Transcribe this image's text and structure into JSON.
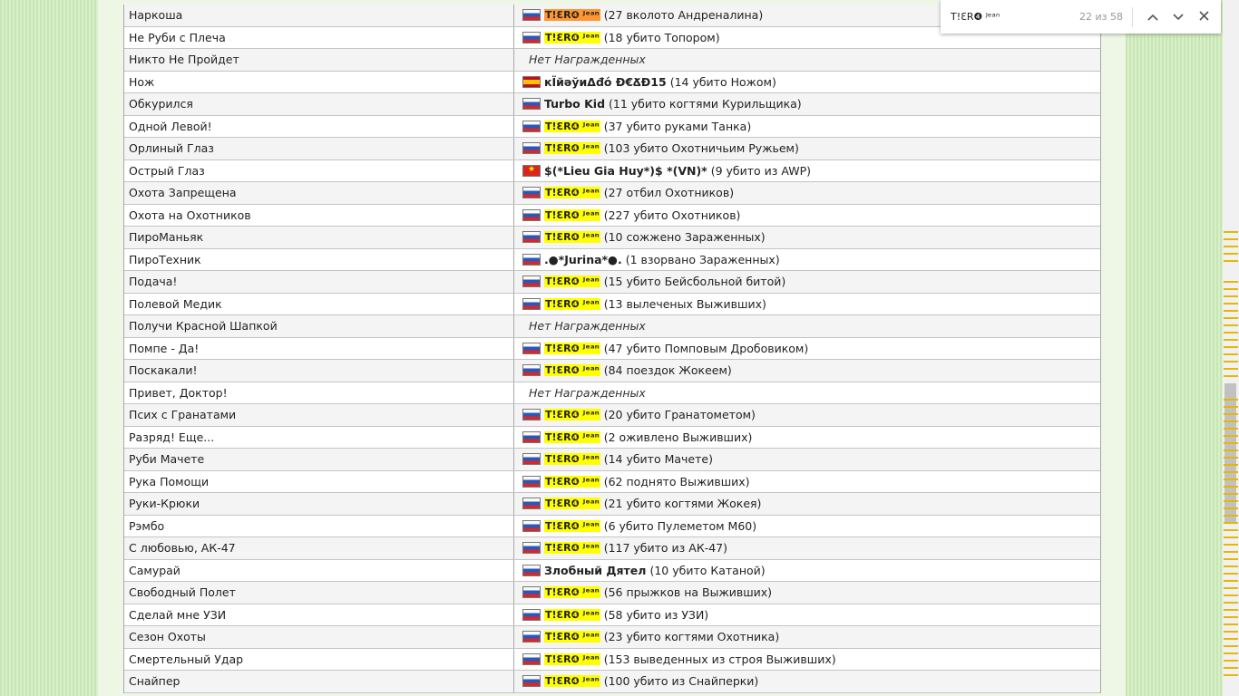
{
  "find": {
    "query": "T!ƐR❹ ᴶᵉᵃⁿ",
    "count": "22 из 58",
    "prev_icon": "chevron-up-icon",
    "next_icon": "chevron-down-icon",
    "close_icon": "close-icon"
  },
  "rows": [
    {
      "award": "Наркоша",
      "flag": "ru",
      "name": "T!ƐR❹ ᴶᵉᵃⁿ",
      "hl": true,
      "current": true,
      "detail": "(27 вколото Андреналина)"
    },
    {
      "award": "Не Руби с Плеча",
      "flag": "ru",
      "name": "T!ƐR❹ ᴶᵉᵃⁿ",
      "hl": true,
      "detail": "(18 убито Топором)"
    },
    {
      "award": "Никто Не Пройдет",
      "none": "Нет Награжденных"
    },
    {
      "award": "Нож",
      "flag": "es",
      "name": "кЇйәўиΔđό Ð€ՃĐ15",
      "detail": "(14 убито Ножом)"
    },
    {
      "award": "Обкурился",
      "flag": "ru",
      "name": "Turbo Kid",
      "detail": "(11 убито когтями Курильщика)"
    },
    {
      "award": "Одной Левой!",
      "flag": "ru",
      "name": "T!ƐR❹ ᴶᵉᵃⁿ",
      "hl": true,
      "detail": "(37 убито руками Танка)"
    },
    {
      "award": "Орлиный Глаз",
      "flag": "ru",
      "name": "T!ƐR❹ ᴶᵉᵃⁿ",
      "hl": true,
      "detail": "(103 убито Охотничьим Ружьем)"
    },
    {
      "award": "Острый Глаз",
      "flag": "vn",
      "name": "$(*Lieu Gia Huy*)$ *(VN)*",
      "detail": "(9 убито из AWP)"
    },
    {
      "award": "Охота Запрещена",
      "flag": "ru",
      "name": "T!ƐR❹ ᴶᵉᵃⁿ",
      "hl": true,
      "detail": "(27 отбил Охотников)"
    },
    {
      "award": "Охота на Охотников",
      "flag": "ru",
      "name": "T!ƐR❹ ᴶᵉᵃⁿ",
      "hl": true,
      "detail": "(227 убито Охотников)"
    },
    {
      "award": "ПироМаньяк",
      "flag": "ru",
      "name": "T!ƐR❹ ᴶᵉᵃⁿ",
      "hl": true,
      "detail": "(10 сожжено Зараженных)"
    },
    {
      "award": "ПироТехник",
      "flag": "ru",
      "name": ".●*Jurina*●.",
      "detail": "(1 взорвано Зараженных)"
    },
    {
      "award": "Подача!",
      "flag": "ru",
      "name": "T!ƐR❹ ᴶᵉᵃⁿ",
      "hl": true,
      "detail": "(15 убито Бейсбольной битой)"
    },
    {
      "award": "Полевой Медик",
      "flag": "ru",
      "name": "T!ƐR❹ ᴶᵉᵃⁿ",
      "hl": true,
      "detail": "(13 вылеченых Выживших)"
    },
    {
      "award": "Получи Красной Шапкой",
      "none": "Нет Награжденных"
    },
    {
      "award": "Помпе - Да!",
      "flag": "ru",
      "name": "T!ƐR❹ ᴶᵉᵃⁿ",
      "hl": true,
      "detail": "(47 убито Помповым Дробовиком)"
    },
    {
      "award": "Поскакали!",
      "flag": "ru",
      "name": "T!ƐR❹ ᴶᵉᵃⁿ",
      "hl": true,
      "detail": "(84 поездок Жокеем)"
    },
    {
      "award": "Привет, Доктор!",
      "none": "Нет Награжденных"
    },
    {
      "award": "Псих с Гранатами",
      "flag": "ru",
      "name": "T!ƐR❹ ᴶᵉᵃⁿ",
      "hl": true,
      "detail": "(20 убито Гранатометом)"
    },
    {
      "award": "Разряд! Еще...",
      "flag": "ru",
      "name": "T!ƐR❹ ᴶᵉᵃⁿ",
      "hl": true,
      "detail": "(2 оживлено Выживших)"
    },
    {
      "award": "Руби Мачете",
      "flag": "ru",
      "name": "T!ƐR❹ ᴶᵉᵃⁿ",
      "hl": true,
      "detail": "(14 убито Мачете)"
    },
    {
      "award": "Рука Помощи",
      "flag": "ru",
      "name": "T!ƐR❹ ᴶᵉᵃⁿ",
      "hl": true,
      "detail": "(62 поднято Выживших)"
    },
    {
      "award": "Руки-Крюки",
      "flag": "ru",
      "name": "T!ƐR❹ ᴶᵉᵃⁿ",
      "hl": true,
      "detail": "(21 убито когтями Жокея)"
    },
    {
      "award": "Рэмбо",
      "flag": "ru",
      "name": "T!ƐR❹ ᴶᵉᵃⁿ",
      "hl": true,
      "detail": "(6 убито Пулеметом M60)"
    },
    {
      "award": "С любовью, АК-47",
      "flag": "ru",
      "name": "T!ƐR❹ ᴶᵉᵃⁿ",
      "hl": true,
      "detail": "(117 убито из АК-47)"
    },
    {
      "award": "Самурай",
      "flag": "ru",
      "name": "Злобный Дятел",
      "detail": "(10 убито Катаной)"
    },
    {
      "award": "Свободный Полет",
      "flag": "ru",
      "name": "T!ƐR❹ ᴶᵉᵃⁿ",
      "hl": true,
      "detail": "(56 прыжков на Выживших)"
    },
    {
      "award": "Сделай мне УЗИ",
      "flag": "ru",
      "name": "T!ƐR❹ ᴶᵉᵃⁿ",
      "hl": true,
      "detail": "(58 убито из УЗИ)"
    },
    {
      "award": "Сезон Охоты",
      "flag": "ru",
      "name": "T!ƐR❹ ᴶᵉᵃⁿ",
      "hl": true,
      "detail": "(23 убито когтями Охотника)"
    },
    {
      "award": "Смертельный Удар",
      "flag": "ru",
      "name": "T!ƐR❹ ᴶᵉᵃⁿ",
      "hl": true,
      "detail": "(153 выведенных из строя Выживших)"
    },
    {
      "award": "Снайпер",
      "flag": "ru",
      "name": "T!ƐR❹ ᴶᵉᵃⁿ",
      "hl": true,
      "detail": "(100 убито из Снайперки)"
    }
  ]
}
